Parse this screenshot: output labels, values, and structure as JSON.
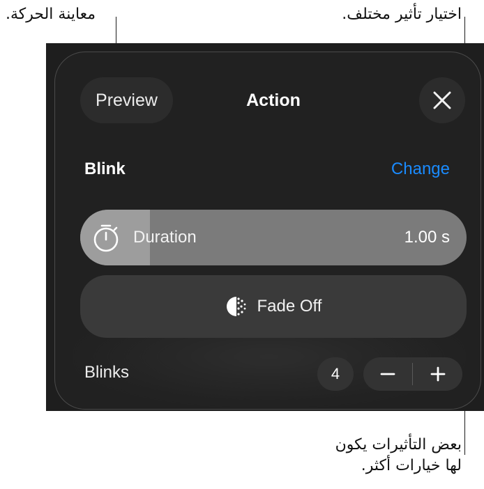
{
  "callouts": {
    "preview": "معاينة الحركة.",
    "change": "اختيار تأثير مختلف.",
    "fade_line1": "بعض التأثيرات يكون",
    "fade_line2": "لها خيارات أكثر."
  },
  "header": {
    "preview_label": "Preview",
    "title": "Action",
    "close_icon": "close-icon"
  },
  "effect": {
    "name": "Blink",
    "change_label": "Change"
  },
  "duration": {
    "icon": "stopwatch-icon",
    "label": "Duration",
    "value": "1.00 s",
    "fill_fraction": 0.18
  },
  "fade": {
    "icon": "fade-icon",
    "label": "Fade Off"
  },
  "blinks": {
    "label": "Blinks",
    "count": "4",
    "minus_icon": "minus-icon",
    "plus_icon": "plus-icon"
  },
  "colors": {
    "accent": "#1a8bff",
    "panel_bg": "#1e1e1e",
    "control_bg": "#2c2c2c"
  }
}
